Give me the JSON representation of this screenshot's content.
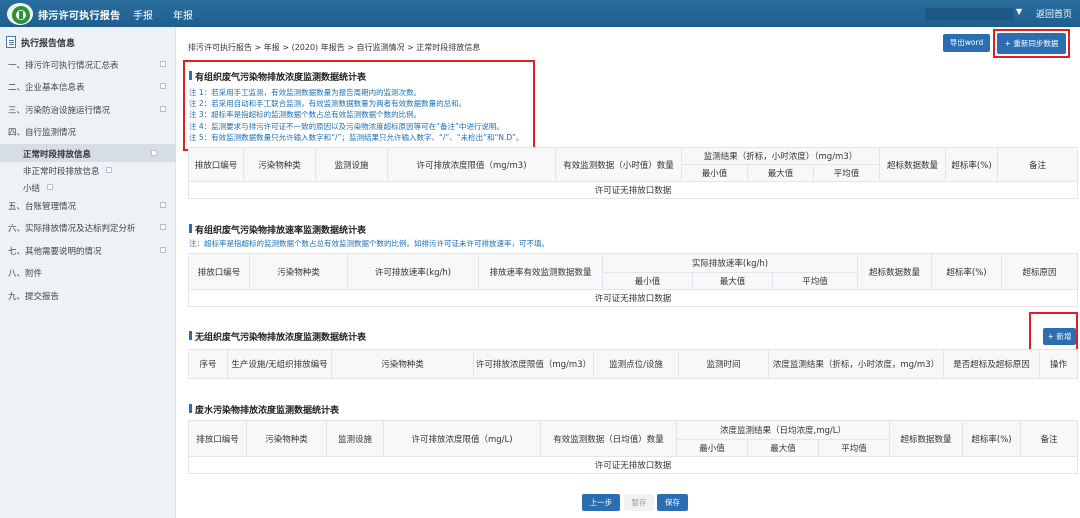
{
  "header": {
    "app_title": "排污许可执行报告",
    "nav": [
      "手报",
      "年报"
    ],
    "home_link": "返回首页"
  },
  "sidebar": {
    "heading": "执行报告信息",
    "items": [
      {
        "label": "一、排污许可执行情况汇总表"
      },
      {
        "label": "二、企业基本信息表"
      },
      {
        "label": "三、污染防治设施运行情况"
      },
      {
        "label": "四、自行监测情况"
      },
      {
        "label": "正常时段排放信息"
      },
      {
        "label": "非正常时段排放信息"
      },
      {
        "label": "小结"
      },
      {
        "label": "五、台账管理情况"
      },
      {
        "label": "六、实际排放情况及达标判定分析"
      },
      {
        "label": "七、其他需要说明的情况"
      },
      {
        "label": "八、附件"
      },
      {
        "label": "九、提交报告"
      }
    ]
  },
  "breadcrumb": "排污许可执行报告 > 年报 > (2020) 年报告 > 自行监测情况 > 正常时段排放信息",
  "toolbar": {
    "export_label": "导出word",
    "resync_label": "+ 重新同步数据"
  },
  "section1": {
    "title": "有组织废气污染物排放浓度监测数据统计表",
    "notes": [
      "注 1：若采用手工监测，有效监测数据数量为报告周期内的监测次数。",
      "注 2：若采用自动和手工联合监测，有效监测数据数量为两者有效数据数量的总和。",
      "注 3：超标率是指超标的监测数据个数占总有效监测数据个数的比例。",
      "注 4：监测要求与排污许可证不一致的原因以及污染物浓度超标原因等可在“备注”中进行说明。",
      "注 5：有效监测数据数量只允许输入数字和“/”；监测结果只允许输入数字、“/”、“未检出”和“N.D”。"
    ],
    "headers": {
      "outlet": "排放口编号",
      "pollutant": "污染物种类",
      "facility": "监测设施",
      "limit": "许可排放浓度限值（mg/m3)",
      "count": "有效监测数据（小时值）数量",
      "result": "监测结果（折标，小时浓度）（mg/m3）",
      "min": "最小值",
      "max": "最大值",
      "avg": "平均值",
      "exceed_count": "超标数据数量",
      "exceed_rate": "超标率(%)",
      "remark": "备注"
    },
    "empty": "许可证无排放口数据"
  },
  "section2": {
    "title": "有组织废气污染物排放速率监测数据统计表",
    "note": "注：超标率是指超标的监测数据个数占总有效监测数据个数的比例。如排污许可证未许可排放速率，可不填。",
    "headers": {
      "outlet": "排放口编号",
      "pollutant": "污染物种类",
      "limit": "许可排放速率(kg/h)",
      "count": "排放速率有效监测数据数量",
      "actual": "实际排放速率(kg/h)",
      "min": "最小值",
      "max": "最大值",
      "avg": "平均值",
      "exceed_count": "超标数据数量",
      "exceed_rate": "超标率(%)",
      "exceed_reason": "超标原因"
    },
    "empty": "许可证无排放口数据"
  },
  "section3": {
    "title": "无组织废气污染物排放浓度监测数据统计表",
    "add_label": "+ 新增",
    "headers": {
      "seq": "序号",
      "facility": "生产设施/无组织排放编号",
      "pollutant": "污染物种类",
      "limit": "许可排放浓度限值（mg/m3）",
      "point": "监测点位/设施",
      "time": "监测时间",
      "result": "浓度监测结果（折标，小时浓度，mg/m3）",
      "exceed": "是否超标及超标原因",
      "op": "操作"
    }
  },
  "section4": {
    "title": "废水污染物排放浓度监测数据统计表",
    "headers": {
      "outlet": "排放口编号",
      "pollutant": "污染物种类",
      "facility": "监测设施",
      "limit": "许可排放浓度限值（mg/L)",
      "count": "有效监测数据（日均值）数量",
      "result": "浓度监测结果（日均浓度,mg/L）",
      "min": "最小值",
      "max": "最大值",
      "avg": "平均值",
      "exceed_count": "超标数据数量",
      "exceed_rate": "超标率(%)",
      "remark": "备注"
    },
    "empty": "许可证无排放口数据"
  },
  "footer": {
    "prev_label": "上一步",
    "temp_label": "暂存",
    "save_label": "保存"
  },
  "colors": {
    "header_bg": "#1f5f8f",
    "primary_button": "#2b6fb2",
    "note_text": "#1a6fb5",
    "highlight_box": "#e02020"
  }
}
